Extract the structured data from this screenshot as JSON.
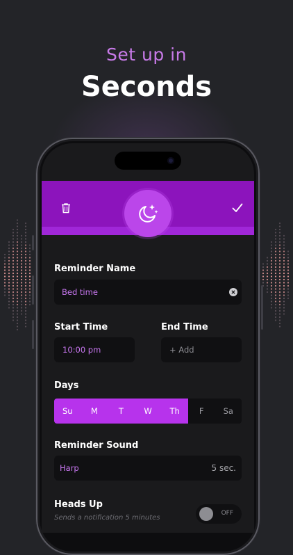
{
  "headline": {
    "subtitle": "Set up in",
    "title": "Seconds"
  },
  "colors": {
    "accent": "#b733ec",
    "topbar": "#8c14bc",
    "background": "#232428",
    "panel": "#1a1a1c",
    "field": "#101012"
  },
  "toolbar": {
    "delete_icon": "trash-icon",
    "confirm_icon": "checkmark-icon",
    "center_icon": "moon-stars-icon"
  },
  "form": {
    "reminder_name": {
      "label": "Reminder Name",
      "value": "Bed time",
      "clear_icon": "clear-circle-icon"
    },
    "start_time": {
      "label": "Start Time",
      "value": "10:00 pm"
    },
    "end_time": {
      "label": "End Time",
      "placeholder": "+ Add"
    },
    "days": {
      "label": "Days",
      "items": [
        {
          "label": "Su",
          "selected": true
        },
        {
          "label": "M",
          "selected": true
        },
        {
          "label": "T",
          "selected": true
        },
        {
          "label": "W",
          "selected": true
        },
        {
          "label": "Th",
          "selected": true
        },
        {
          "label": "F",
          "selected": false
        },
        {
          "label": "Sa",
          "selected": false
        }
      ]
    },
    "reminder_sound": {
      "label": "Reminder Sound",
      "value": "Harp",
      "duration": "5 sec."
    },
    "heads_up": {
      "label": "Heads Up",
      "description": "Sends a notification 5 minutes",
      "toggle_state": "OFF"
    }
  }
}
